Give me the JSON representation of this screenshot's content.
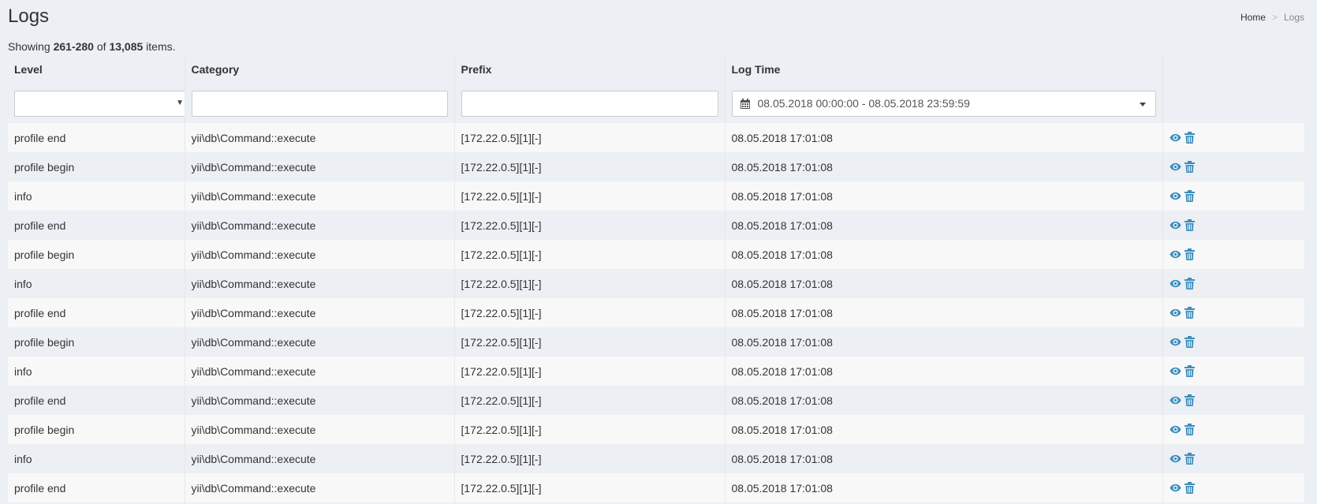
{
  "page": {
    "title": "Logs"
  },
  "breadcrumb": {
    "home": "Home",
    "separator": ">",
    "current": "Logs"
  },
  "summary": {
    "prefix": "Showing",
    "range": "261-280",
    "of": "of",
    "total": "13,085",
    "suffix": "items."
  },
  "columns": {
    "level": "Level",
    "category": "Category",
    "prefix": "Prefix",
    "log_time": "Log Time"
  },
  "filters": {
    "level_value": "",
    "category_value": "",
    "prefix_value": "",
    "log_time_range": "08.05.2018 00:00:00 - 08.05.2018 23:59:59"
  },
  "icons": {
    "view": "eye-icon",
    "delete": "trash-icon",
    "calendar": "calendar-icon",
    "accent_color": "#3c8dbc"
  },
  "rows": [
    {
      "level": "profile end",
      "category": "yii\\db\\Command::execute",
      "prefix": "[172.22.0.5][1][-]",
      "log_time": "08.05.2018 17:01:08"
    },
    {
      "level": "profile begin",
      "category": "yii\\db\\Command::execute",
      "prefix": "[172.22.0.5][1][-]",
      "log_time": "08.05.2018 17:01:08"
    },
    {
      "level": "info",
      "category": "yii\\db\\Command::execute",
      "prefix": "[172.22.0.5][1][-]",
      "log_time": "08.05.2018 17:01:08"
    },
    {
      "level": "profile end",
      "category": "yii\\db\\Command::execute",
      "prefix": "[172.22.0.5][1][-]",
      "log_time": "08.05.2018 17:01:08"
    },
    {
      "level": "profile begin",
      "category": "yii\\db\\Command::execute",
      "prefix": "[172.22.0.5][1][-]",
      "log_time": "08.05.2018 17:01:08"
    },
    {
      "level": "info",
      "category": "yii\\db\\Command::execute",
      "prefix": "[172.22.0.5][1][-]",
      "log_time": "08.05.2018 17:01:08"
    },
    {
      "level": "profile end",
      "category": "yii\\db\\Command::execute",
      "prefix": "[172.22.0.5][1][-]",
      "log_time": "08.05.2018 17:01:08"
    },
    {
      "level": "profile begin",
      "category": "yii\\db\\Command::execute",
      "prefix": "[172.22.0.5][1][-]",
      "log_time": "08.05.2018 17:01:08"
    },
    {
      "level": "info",
      "category": "yii\\db\\Command::execute",
      "prefix": "[172.22.0.5][1][-]",
      "log_time": "08.05.2018 17:01:08"
    },
    {
      "level": "profile end",
      "category": "yii\\db\\Command::execute",
      "prefix": "[172.22.0.5][1][-]",
      "log_time": "08.05.2018 17:01:08"
    },
    {
      "level": "profile begin",
      "category": "yii\\db\\Command::execute",
      "prefix": "[172.22.0.5][1][-]",
      "log_time": "08.05.2018 17:01:08"
    },
    {
      "level": "info",
      "category": "yii\\db\\Command::execute",
      "prefix": "[172.22.0.5][1][-]",
      "log_time": "08.05.2018 17:01:08"
    },
    {
      "level": "profile end",
      "category": "yii\\db\\Command::execute",
      "prefix": "[172.22.0.5][1][-]",
      "log_time": "08.05.2018 17:01:08"
    }
  ]
}
